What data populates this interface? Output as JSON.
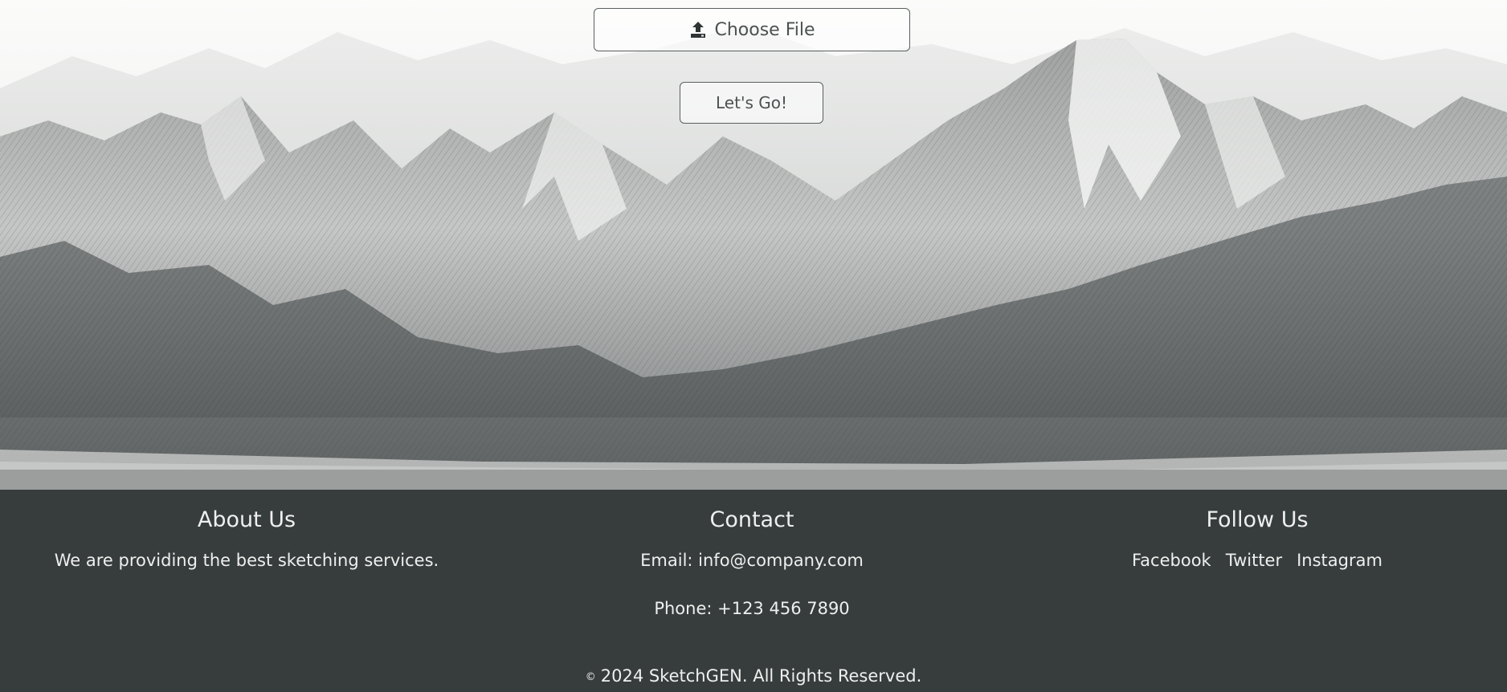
{
  "upload": {
    "label": "Choose File",
    "icon": "upload-icon"
  },
  "actions": {
    "go_label": "Let's Go!"
  },
  "footer": {
    "about": {
      "heading": "About Us",
      "text": "We are providing the best sketching services."
    },
    "contact": {
      "heading": "Contact",
      "email": "Email: info@company.com",
      "phone": "Phone: +123 456 7890"
    },
    "follow": {
      "heading": "Follow Us",
      "links": [
        "Facebook",
        "Twitter",
        "Instagram"
      ]
    },
    "copyright_symbol": "©",
    "copyright": "2024 SketchGEN. All Rights Reserved."
  },
  "colors": {
    "footer_bg": "#373c3c",
    "footer_text": "#eef0ee",
    "button_border": "#5a5f5f"
  }
}
